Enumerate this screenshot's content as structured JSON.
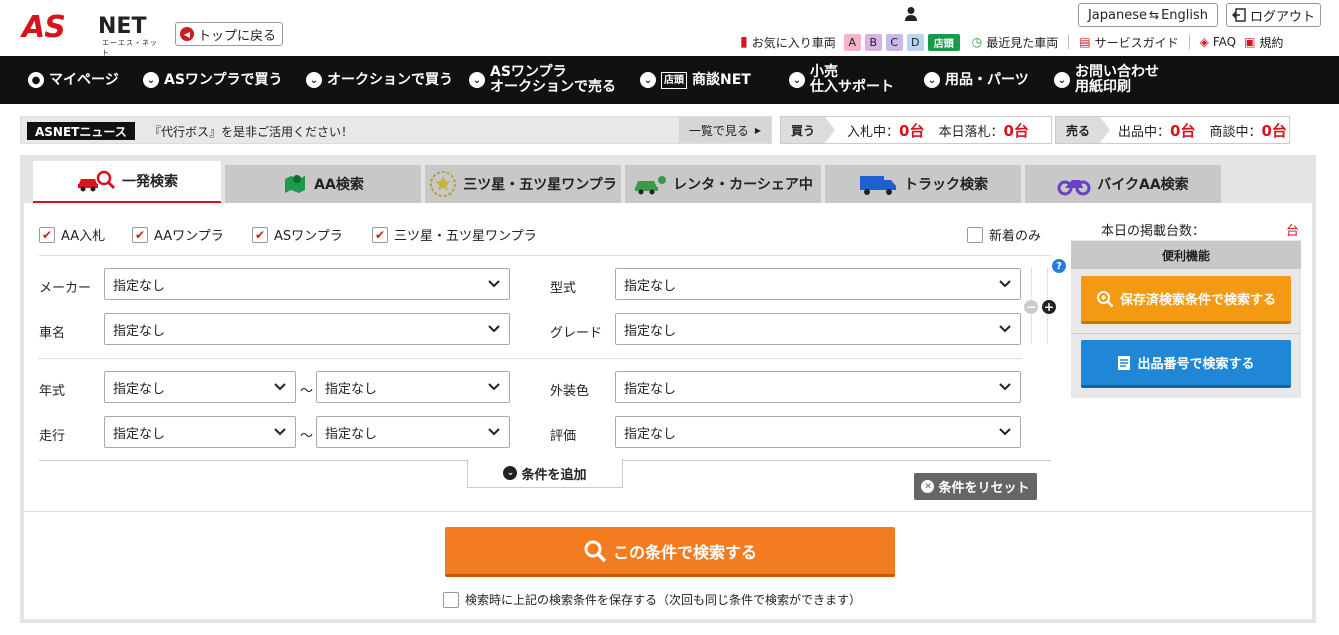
{
  "header": {
    "logo_as": "AS",
    "logo_net": "NET",
    "logo_sub": "エーエス・ネット",
    "back_to_top": "トップに戻る",
    "lang_from": "Japanese",
    "lang_to": "English",
    "logout": "ログアウト",
    "favorites": "お気に入り車両",
    "fav_slots": [
      "A",
      "B",
      "C",
      "D"
    ],
    "store_badge": "店頭",
    "recent": "最近見た車両",
    "service_guide": "サービスガイド",
    "faq": "FAQ",
    "terms": "規約"
  },
  "nav": [
    {
      "label": "マイページ",
      "icon": "user-icon"
    },
    {
      "label": "ASワンプラで買う",
      "icon": "chevron-down-icon"
    },
    {
      "label": "オークションで買う",
      "icon": "chevron-down-icon"
    },
    {
      "label": "ASワンプラ\nオークションで売る",
      "icon": "chevron-down-icon"
    },
    {
      "label": "商談NET",
      "icon": "chevron-down-icon",
      "badge": "店頭"
    },
    {
      "label": "小売\n仕入サポート",
      "icon": "chevron-down-icon"
    },
    {
      "label": "用品・パーツ",
      "icon": "chevron-down-icon"
    },
    {
      "label": "お問い合わせ\n用紙印刷",
      "icon": "chevron-down-icon"
    }
  ],
  "news": {
    "tag": "ASNETニュース",
    "text": "『代行ボス』を是非ご活用ください！",
    "more": "一覧で見る"
  },
  "buy_stats": {
    "tag": "買う",
    "bidding_label": "入札中：",
    "bidding_value": "0台",
    "won_label": "本日落札：",
    "won_value": "0台"
  },
  "sell_stats": {
    "tag": "売る",
    "listing_label": "出品中：",
    "listing_value": "0台",
    "nego_label": "商談中：",
    "nego_value": "0台"
  },
  "tabs": [
    {
      "label": "一発検索",
      "icon": "car-search-icon",
      "active": true
    },
    {
      "label": "AA検索",
      "icon": "map-pin-icon"
    },
    {
      "label": "三ツ星・五ツ星ワンプラ",
      "icon": "star-badge-icon"
    },
    {
      "label": "レンタ・カーシェア中",
      "icon": "rental-car-icon"
    },
    {
      "label": "トラック検索",
      "icon": "truck-icon"
    },
    {
      "label": "バイクAA検索",
      "icon": "motorcycle-icon"
    }
  ],
  "filters": {
    "aa_bid": "AA入札",
    "aa_onepra": "AAワンプラ",
    "as_onepra": "ASワンプラ",
    "star_onepra": "三ツ星・五ツ星ワンプラ",
    "new_only": "新着のみ"
  },
  "form": {
    "maker_label": "メーカー",
    "model_label": "型式",
    "car_name_label": "車名",
    "grade_label": "グレード",
    "year_label": "年式",
    "color_label": "外装色",
    "mileage_label": "走行",
    "rating_label": "評価",
    "unspecified": "指定なし",
    "tilde": "～",
    "add_condition": "条件を追加",
    "reset": "条件をリセット",
    "search": "この条件で検索する",
    "save_note": "検索時に上記の検索条件を保存する（次回も同じ条件で検索ができます）"
  },
  "side": {
    "count_label": "本日の掲載台数：",
    "count_unit": "台",
    "tools_head": "便利機能",
    "saved_search": "保存済検索条件で検索する",
    "lot_search": "出品番号で検索する",
    "help": "?"
  },
  "colors": {
    "brand_red": "#d7141c",
    "orange": "#f47c20",
    "blue": "#1f87d6",
    "fav_a": "#f6b2c6",
    "fav_b": "#d9b3e6",
    "fav_c": "#c8b8ee",
    "fav_d": "#b7d4f2",
    "store": "#1a9a4a"
  }
}
